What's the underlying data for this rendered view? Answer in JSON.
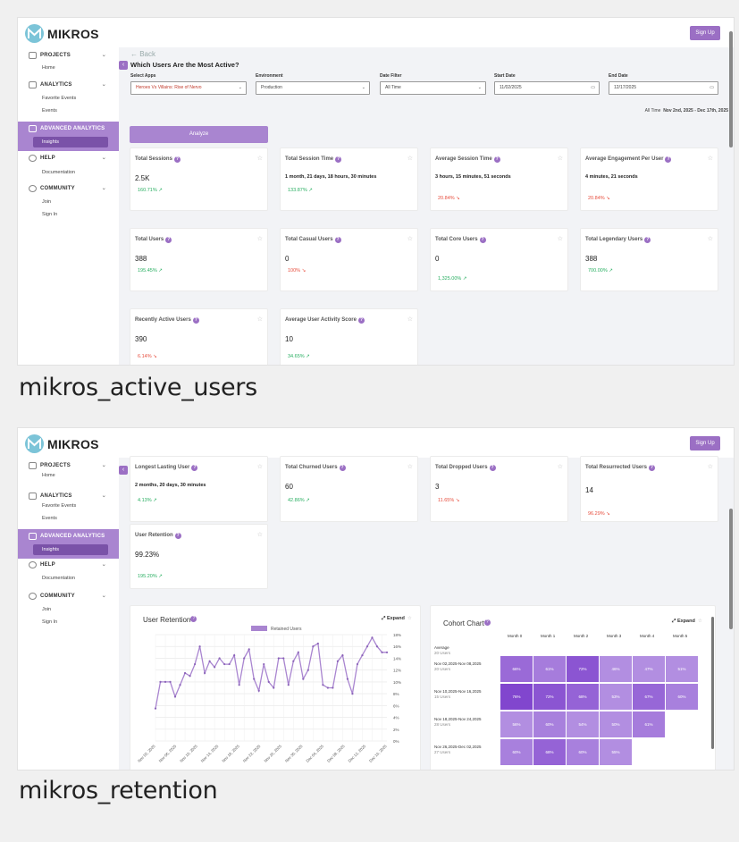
{
  "captions": {
    "first": "mikros_active_users",
    "second": "mikros_retention"
  },
  "brand": {
    "name": "MIKROS",
    "signup": "Sign Up",
    "accent": "#9b6fc4",
    "active_bg": "#a985d0",
    "active_item_bg": "#7a52a8"
  },
  "sidebar": {
    "projects": "PROJECTS",
    "home": "Home",
    "analytics": "ANALYTICS",
    "favorite_events": "Favorite Events",
    "events": "Events",
    "advanced": "ADVANCED ANALYTICS",
    "insights": "Insights",
    "help": "HELP",
    "documentation": "Documentation",
    "community": "COMMUNITY",
    "join": "Join",
    "sign_in": "Sign In"
  },
  "page1": {
    "back": "← Back",
    "title": "Which Users Are the Most Active?",
    "filters": {
      "select_apps_label": "Select Apps",
      "select_apps_value": "Heroes Vs Villains: Rise of Nervo",
      "environment_label": "Environment",
      "environment_value": "Production",
      "date_filter_label": "Date Filter",
      "date_filter_value": "All Time",
      "start_date_label": "Start Date",
      "start_date_value": "11/02/2025",
      "end_date_label": "End Date",
      "end_date_value": "12/17/2025"
    },
    "range_label": "All Time",
    "range_value": "Nov 2nd, 2025 - Dec 17th, 2025",
    "analyze": "Analyze",
    "cards": [
      {
        "title": "Total Sessions",
        "value": "2.5K",
        "change": "160.71%",
        "dir": "up"
      },
      {
        "title": "Total Session Time",
        "value": "1 month, 21 days, 18 hours, 30 minutes",
        "change": "133.87%",
        "dir": "up"
      },
      {
        "title": "Average Session Time",
        "value": "3 hours, 15 minutes, 51 seconds",
        "change": "20.84%",
        "dir": "down"
      },
      {
        "title": "Average Engagement Per User",
        "value": "4 minutes, 21 seconds",
        "change": "20.84%",
        "dir": "down"
      },
      {
        "title": "Total Users",
        "value": "388",
        "change": "195.45%",
        "dir": "up"
      },
      {
        "title": "Total Casual Users",
        "value": "0",
        "change": "100%",
        "dir": "down"
      },
      {
        "title": "Total Core Users",
        "value": "0",
        "change": "1,325.00%",
        "dir": "up"
      },
      {
        "title": "Total Legendary Users",
        "value": "388",
        "change": "700.00%",
        "dir": "up"
      },
      {
        "title": "Recently Active Users",
        "value": "390",
        "change": "6.14%",
        "dir": "down"
      },
      {
        "title": "Average User Activity Score",
        "value": "10",
        "change": "34.65%",
        "dir": "up"
      }
    ]
  },
  "page2": {
    "cards": [
      {
        "title": "Longest Lasting User",
        "value": "2 months, 20 days, 30 minutes",
        "change": "4.13%",
        "dir": "up"
      },
      {
        "title": "Total Churned Users",
        "value": "60",
        "change": "42.86%",
        "dir": "up"
      },
      {
        "title": "Total Dropped Users",
        "value": "3",
        "change": "11.65%",
        "dir": "down"
      },
      {
        "title": "Total Resurrected Users",
        "value": "14",
        "change": "96.29%",
        "dir": "down"
      },
      {
        "title": "User Retention",
        "value": "99.23%",
        "change": "195.20%",
        "dir": "up"
      }
    ],
    "retention_title": "User Retention",
    "cohort_title": "Cohort Chart",
    "expand": "Expand",
    "cohort": {
      "months": [
        "Month 0",
        "Month 1",
        "Month 2",
        "Month 3",
        "Month 4",
        "Month 5"
      ],
      "rows": [
        {
          "label": "Average",
          "sub": "20 Users",
          "values": []
        },
        {
          "label": "Nov 02,2025-Nov 08,2025",
          "sub": "20 Users",
          "values": [
            "66%",
            "61%",
            "72%",
            "46%",
            "47%",
            "51%"
          ]
        },
        {
          "label": "Nov 10,2025-Nov 16,2025",
          "sub": "15 Users",
          "values": [
            "76%",
            "72%",
            "68%",
            "53%",
            "67%",
            "60%"
          ]
        },
        {
          "label": "Nov 18,2025-Nov 24,2025",
          "sub": "28 Users",
          "values": [
            "56%",
            "60%",
            "54%",
            "50%",
            "61%"
          ]
        },
        {
          "label": "Nov 26,2025-Dec 02,2025",
          "sub": "27 Users",
          "values": [
            "60%",
            "68%",
            "60%",
            "55%"
          ]
        }
      ]
    }
  },
  "chart_data": {
    "type": "line",
    "title": "User Retention",
    "series": [
      {
        "name": "Retained Users",
        "color": "#a985d0",
        "values": [
          5.5,
          10,
          10,
          10,
          7.5,
          9.5,
          11.5,
          11,
          13,
          16,
          11.5,
          13.5,
          12.5,
          14,
          13,
          13,
          14.5,
          9.5,
          14,
          15.5,
          10.5,
          8.5,
          13,
          10,
          9,
          14,
          14,
          9.5,
          13.5,
          15,
          10.5,
          12,
          16,
          16.5,
          9.5,
          9,
          9,
          13.5,
          14.5,
          10.5,
          8,
          13,
          14.5,
          16,
          17.5,
          16,
          15,
          15
        ]
      }
    ],
    "x_ticks": [
      "Nov 02, 2025",
      "Nov 06, 2025",
      "Nov 10, 2025",
      "Nov 14, 2025",
      "Nov 18, 2025",
      "Nov 22, 2025",
      "Nov 26, 2025",
      "Nov 30, 2025",
      "Dec 04, 2025",
      "Dec 08, 2025",
      "Dec 12, 2025",
      "Dec 16, 2025"
    ],
    "y_ticks": [
      "0%",
      "2%",
      "4%",
      "6%",
      "8%",
      "10%",
      "12%",
      "14%",
      "16%",
      "18%"
    ],
    "ylim": [
      0,
      18
    ],
    "grid": true,
    "legend": "top"
  }
}
